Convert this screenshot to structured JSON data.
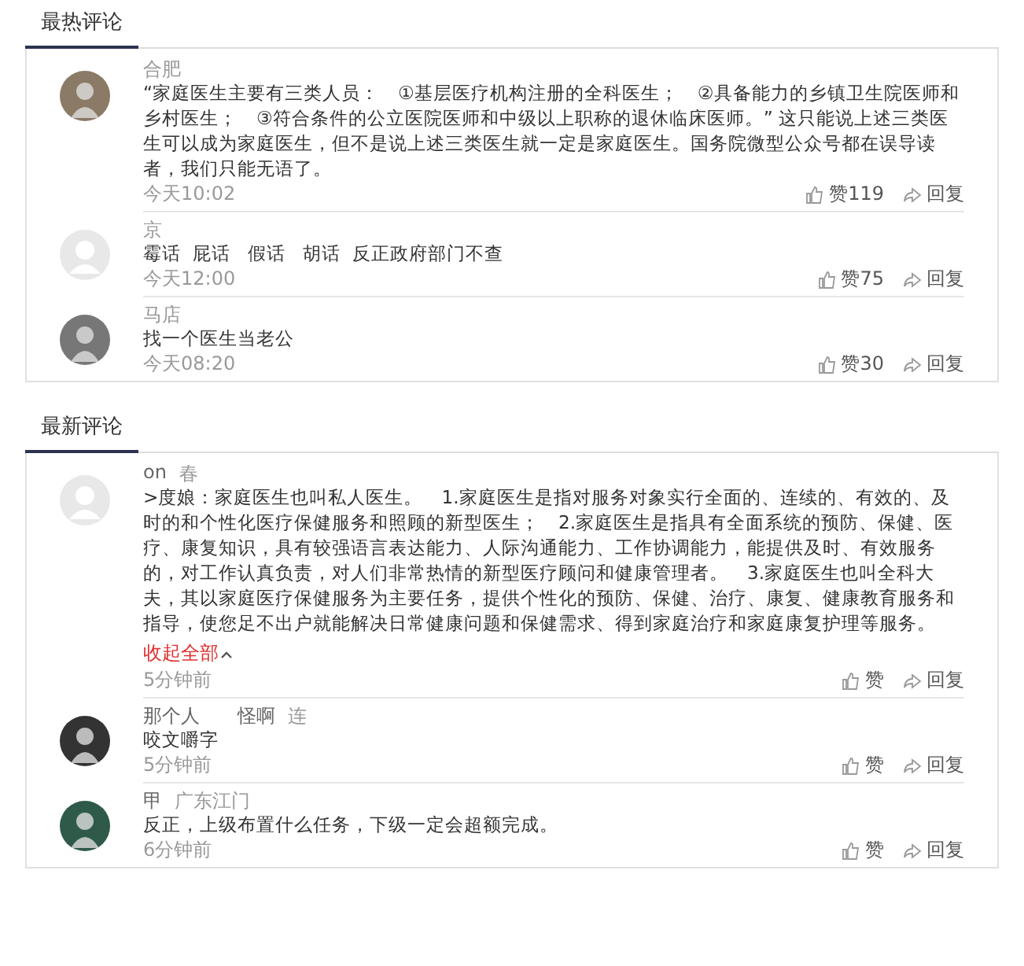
{
  "sections": [
    {
      "title": "最热评论",
      "comments": [
        {
          "avatar": {
            "kind": "photo",
            "color": "#8a7a66"
          },
          "location": "合肥",
          "text": "“家庭医生主要有三类人员：　①基层医疗机构注册的全科医生；　②具备能力的乡镇卫生院医师和乡村医生；　③符合条件的公立医院医师和中级以上职称的退休临床医师。” 这只能说上述三类医生可以成为家庭医生，但不是说上述三类医生就一定是家庭医生。国务院微型公众号都在误导读者，我们只能无语了。",
          "time": "今天10:02",
          "like": "赞119",
          "reply": "回复"
        },
        {
          "avatar": {
            "kind": "default",
            "color": "#e8e8e8"
          },
          "location": "京",
          "text": "霉话  屁话   假话   胡话  反正政府部门不查",
          "time": "今天12:00",
          "like": "赞75",
          "reply": "回复"
        },
        {
          "avatar": {
            "kind": "photo",
            "color": "#777777"
          },
          "location": "马店",
          "text": "找一个医生当老公",
          "time": "今天08:20",
          "like": "赞30",
          "reply": "回复"
        }
      ]
    },
    {
      "title": "最新评论",
      "comments": [
        {
          "avatar": {
            "kind": "default",
            "color": "#e8e8e8"
          },
          "name": "on",
          "location": "春",
          "text": ">度娘：家庭医生也叫私人医生。　1.家庭医生是指对服务对象实行全面的、连续的、有效的、及时的和个性化医疗保健服务和照顾的新型医生；　2.家庭医生是指具有全面系统的预防、保健、医疗、康复知识，具有较强语言表达能力、人际沟通能力、工作协调能力，能提供及时、有效服务的，对工作认真负责，对人们非常热情的新型医疗顾问和健康管理者。　3.家庭医生也叫全科大夫，其以家庭医疗保健服务为主要任务，提供个性化的预防、保健、治疗、康复、健康教育服务和指导，使您足不出户就能解决日常健康问题和保健需求、得到家庭治疗和家庭康复护理等服务。",
          "expand": "收起全部",
          "time": "5分钟前",
          "like": "赞",
          "reply": "回复"
        },
        {
          "avatar": {
            "kind": "photo",
            "color": "#333333"
          },
          "name": "那个人　　怪啊",
          "location": "连",
          "text": "咬文嚼字",
          "time": "5分钟前",
          "like": "赞",
          "reply": "回复"
        },
        {
          "avatar": {
            "kind": "photo",
            "color": "#2f5a4a"
          },
          "name": "甲",
          "location": "广东江门",
          "text": "反正，上级布置什么任务，下级一定会超额完成。",
          "time": "6分钟前",
          "like": "赞",
          "reply": "回复"
        }
      ]
    }
  ]
}
